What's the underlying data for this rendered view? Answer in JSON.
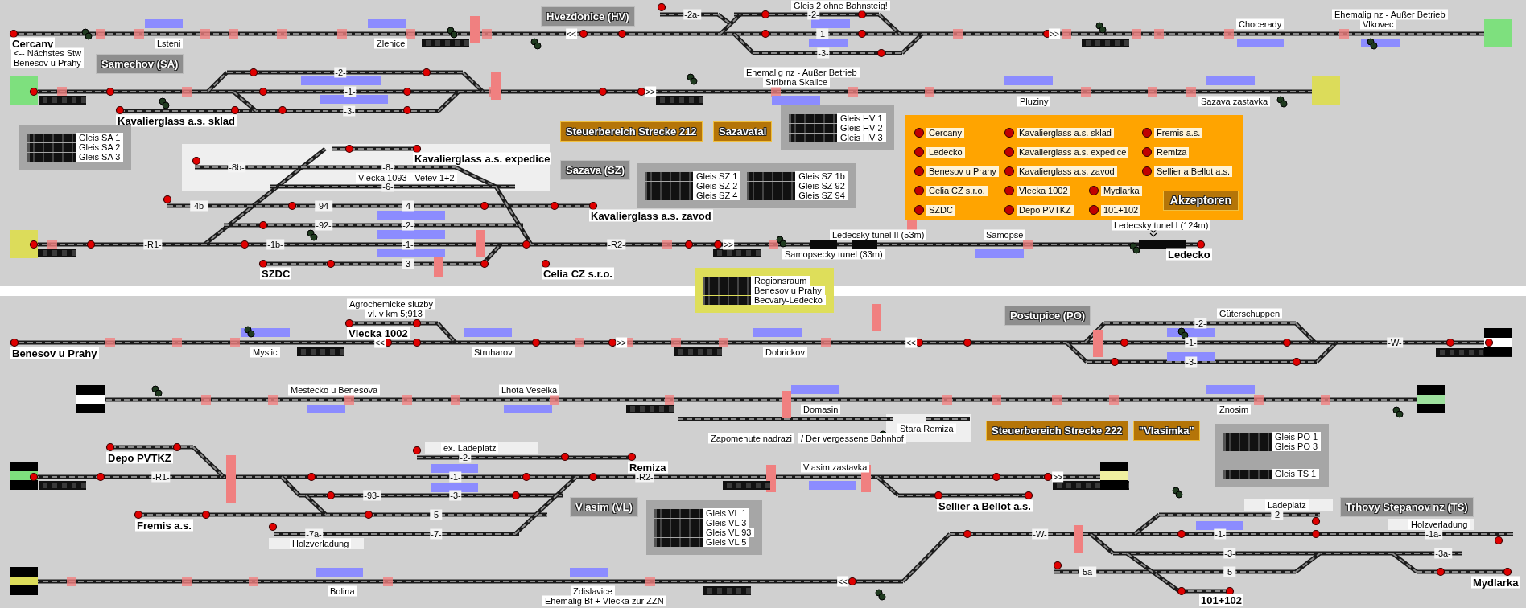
{
  "station_names": [
    "Cercany",
    "Kavalierglass a.s. sklad",
    "Kavalierglass a.s. expedice",
    "SZDC",
    "Kavalierglass a.s. zavod",
    "Celia CZ s.r.o.",
    "Ledecko",
    "Vlecka 1002",
    "Benesov u Prahy",
    "Depo PVTKZ",
    "Remiza",
    "Fremis a.s.",
    "Sellier a Bellot a.s.",
    "Mydlarka",
    "101+102"
  ],
  "place_labels": [
    "<-- Nächstes Stw",
    "Benesov u Prahy",
    "Lsteni",
    "Zlenice",
    "Gleis 2 ohne Bahnsteig!",
    "Ehemalig nz - Außer Betrieb",
    "Stribrna Skalice",
    "Chocerady",
    "Ehemalig nz - Außer Betrieb",
    "Vlkovec",
    "Pluziny",
    "Sazava zastavka",
    "Vlecka 1093 - Vetev 1+2",
    "Ledecsky tunel II (53m)",
    "Samopsecky tunel (33m)",
    "Samopse",
    "Ledecsky tunel I (124m)",
    "Agrochemicke sluzby",
    "vl. v km 5;913",
    "Myslic",
    "Struharov",
    "Dobrickov",
    "Güterschuppen",
    "Mestecko u Benesova",
    "Lhota Veselka",
    "Domasin",
    "Znosim",
    "Stara Remiza",
    "Zapomenute nadrazi",
    "/ Der vergessene Bahnhof",
    "ex. Ladeplatz",
    "Vlasim zastavka",
    "Ladeplatz",
    "Holzverladung",
    "Holzverladung",
    "Bolina",
    "Zdislavice",
    "Ehemalig Bf + Vlecka zur ZZN"
  ],
  "track_labels": [
    "-2a-",
    "-2-",
    "-1-",
    "-3-",
    "-2-",
    "-1-",
    "-3-",
    "-8b-",
    "-8-",
    "-6-",
    "-4b-",
    "-94-",
    "-4-",
    "-92-",
    "-2-",
    "-R1-",
    "-1b-",
    "-1-",
    "-3-",
    "-R2-",
    "-2-",
    "-1-",
    "-3-",
    "-W-",
    "-R1-",
    "-2-",
    "-1-",
    "-93-",
    "-3-",
    "-5-",
    "-7a-",
    "-7-",
    "-R2-",
    "-W-",
    "-2-",
    "-1-",
    "-1a-",
    "-3-",
    "-3a-",
    "-5a-",
    "-5-"
  ],
  "direction_marks": [
    "<<",
    ">>",
    ">>",
    ">>",
    "<<",
    ">>",
    "<<",
    ">>",
    "<<"
  ],
  "headers": [
    {
      "text": "Hvezdonice (HV)",
      "kind": "station"
    },
    {
      "text": "Samechov (SA)",
      "kind": "station"
    },
    {
      "text": "Steuerbereich Strecke 212",
      "kind": "area"
    },
    {
      "text": "Sazavatal",
      "kind": "area"
    },
    {
      "text": "Sazava (SZ)",
      "kind": "station"
    },
    {
      "text": "Postupice (PO)",
      "kind": "station"
    },
    {
      "text": "Steuerbereich Strecke 222",
      "kind": "area"
    },
    {
      "text": "\"Vlasimka\"",
      "kind": "area"
    },
    {
      "text": "Vlasim (VL)",
      "kind": "station"
    },
    {
      "text": "Trhovy Stepanov nz (TS)",
      "kind": "station"
    }
  ],
  "track_panels": [
    {
      "kind": "station",
      "groups": [
        [
          "Gleis SA 1",
          "Gleis SA 2",
          "Gleis SA 3"
        ]
      ]
    },
    {
      "kind": "station",
      "groups": [
        [
          "Gleis HV 1",
          "Gleis HV 2",
          "Gleis HV 3"
        ]
      ]
    },
    {
      "kind": "station",
      "columns": [
        [
          "Gleis SZ 1",
          "Gleis SZ 2",
          "Gleis SZ 4"
        ],
        [
          "Gleis SZ 1b",
          "Gleis SZ 92",
          "Gleis SZ 94"
        ]
      ]
    },
    {
      "kind": "region",
      "groups": [
        [
          "Regionsraum",
          "Benesov u Prahy",
          "Becvary-Ledecko"
        ]
      ]
    },
    {
      "kind": "station",
      "groups": [
        [
          "Gleis VL 1",
          "Gleis VL 3",
          "Gleis VL 93",
          "Gleis VL 5"
        ]
      ]
    },
    {
      "kind": "station",
      "groups": [
        [
          "Gleis PO 1",
          "Gleis PO 3"
        ],
        [
          "Gleis TS 1"
        ]
      ]
    }
  ],
  "acceptor_legend": {
    "title": "Akzeptoren",
    "items": [
      "Cercany",
      "Kavalierglass a.s. sklad",
      "Fremis a.s.",
      "Ledecko",
      "Kavalierglass a.s. expedice",
      "Remiza",
      "Benesov u Prahy",
      "Kavalierglass a.s. zavod",
      "Sellier a Bellot a.s.",
      "Celia CZ s.r.o.",
      "Vlecka 1002",
      "Mydlarka",
      "SZDC",
      "Depo PVTKZ",
      "101+102"
    ]
  }
}
